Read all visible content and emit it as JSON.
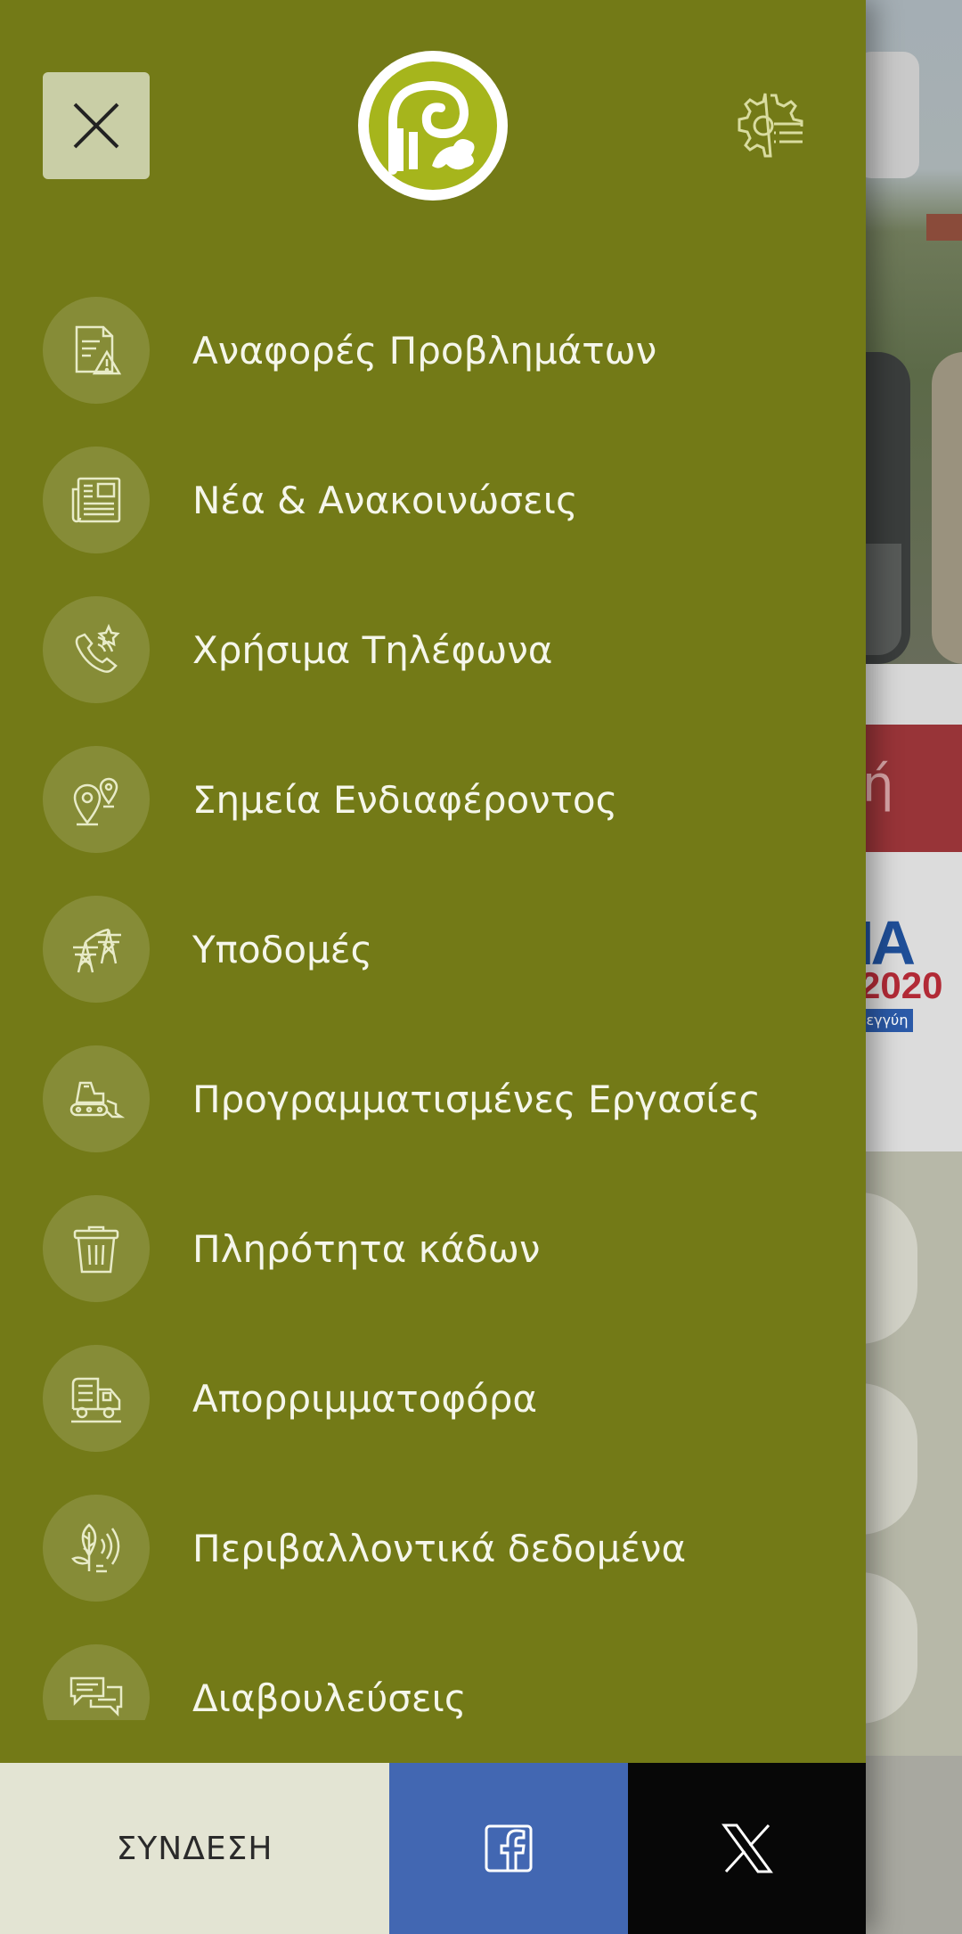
{
  "drawer": {
    "background_color": "#737a17",
    "close_icon": "close-icon",
    "logo_icon": "municipality-logo",
    "settings_icon": "settings-list-icon"
  },
  "menu": {
    "items": [
      {
        "label": "Αναφορές Προβλημάτων",
        "icon": "problem-report-icon"
      },
      {
        "label": "Νέα & Ανακοινώσεις",
        "icon": "newspaper-icon"
      },
      {
        "label": "Χρήσιμα Τηλέφωνα",
        "icon": "phone-star-icon"
      },
      {
        "label": "Σημεία Ενδιαφέροντος",
        "icon": "map-pin-icon"
      },
      {
        "label": "Υποδομές",
        "icon": "power-tower-icon"
      },
      {
        "label": "Προγραμματισμένες Εργασίες",
        "icon": "bulldozer-icon"
      },
      {
        "label": "Πληρότητα κάδων",
        "icon": "trash-bin-icon"
      },
      {
        "label": "Απορριμματοφόρα",
        "icon": "garbage-truck-icon"
      },
      {
        "label": "Περιβαλλοντικά δεδομένα",
        "icon": "leaf-sensor-icon"
      },
      {
        "label": "Διαβουλεύσεις",
        "icon": "chat-bubbles-icon"
      }
    ]
  },
  "bottom_bar": {
    "login_label": "ΣΥΝΔΕΣΗ",
    "facebook_icon": "facebook-icon",
    "x_icon": "x-twitter-icon",
    "facebook_color": "#4267b2",
    "x_color": "#070707"
  },
  "background": {
    "banner_fragment": "ή",
    "logo_fragment_top": "ΙΑ",
    "logo_fragment_year": "2020",
    "logo_fragment_sub": "λεγγύη"
  }
}
